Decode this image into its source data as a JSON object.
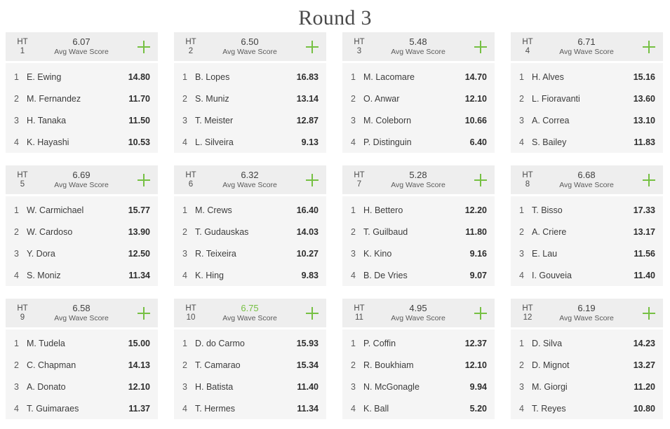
{
  "page": {
    "title": "Round 3",
    "heat_label": "HT",
    "avg_caption": "Avg Wave Score",
    "add_icon": "plus-icon",
    "accent_color": "#76c043",
    "header_bg": "#eeeeee",
    "body_bg": "#f5f5f5"
  },
  "heats": [
    {
      "heat_label": "HT",
      "heat_number": "1",
      "avg_wave_score": "6.07",
      "avg_caption": "Avg Wave Score",
      "highlighted": false,
      "athletes": [
        {
          "rank": "1",
          "name": "E. Ewing",
          "score": "14.80"
        },
        {
          "rank": "2",
          "name": "M. Fernandez",
          "score": "11.70"
        },
        {
          "rank": "3",
          "name": "H. Tanaka",
          "score": "11.50"
        },
        {
          "rank": "4",
          "name": "K. Hayashi",
          "score": "10.53"
        }
      ]
    },
    {
      "heat_label": "HT",
      "heat_number": "2",
      "avg_wave_score": "6.50",
      "avg_caption": "Avg Wave Score",
      "highlighted": false,
      "athletes": [
        {
          "rank": "1",
          "name": "B. Lopes",
          "score": "16.83"
        },
        {
          "rank": "2",
          "name": "S. Muniz",
          "score": "13.14"
        },
        {
          "rank": "3",
          "name": "T. Meister",
          "score": "12.87"
        },
        {
          "rank": "4",
          "name": "L. Silveira",
          "score": "9.13"
        }
      ]
    },
    {
      "heat_label": "HT",
      "heat_number": "3",
      "avg_wave_score": "5.48",
      "avg_caption": "Avg Wave Score",
      "highlighted": false,
      "athletes": [
        {
          "rank": "1",
          "name": "M. Lacomare",
          "score": "14.70"
        },
        {
          "rank": "2",
          "name": "O. Anwar",
          "score": "12.10"
        },
        {
          "rank": "3",
          "name": "M. Coleborn",
          "score": "10.66"
        },
        {
          "rank": "4",
          "name": "P. Distinguin",
          "score": "6.40"
        }
      ]
    },
    {
      "heat_label": "HT",
      "heat_number": "4",
      "avg_wave_score": "6.71",
      "avg_caption": "Avg Wave Score",
      "highlighted": false,
      "athletes": [
        {
          "rank": "1",
          "name": "H. Alves",
          "score": "15.16"
        },
        {
          "rank": "2",
          "name": "L. Fioravanti",
          "score": "13.60"
        },
        {
          "rank": "3",
          "name": "A. Correa",
          "score": "13.10"
        },
        {
          "rank": "4",
          "name": "S. Bailey",
          "score": "11.83"
        }
      ]
    },
    {
      "heat_label": "HT",
      "heat_number": "5",
      "avg_wave_score": "6.69",
      "avg_caption": "Avg Wave Score",
      "highlighted": false,
      "athletes": [
        {
          "rank": "1",
          "name": "W. Carmichael",
          "score": "15.77"
        },
        {
          "rank": "2",
          "name": "W. Cardoso",
          "score": "13.90"
        },
        {
          "rank": "3",
          "name": "Y. Dora",
          "score": "12.50"
        },
        {
          "rank": "4",
          "name": "S. Moniz",
          "score": "11.34"
        }
      ]
    },
    {
      "heat_label": "HT",
      "heat_number": "6",
      "avg_wave_score": "6.32",
      "avg_caption": "Avg Wave Score",
      "highlighted": false,
      "athletes": [
        {
          "rank": "1",
          "name": "M. Crews",
          "score": "16.40"
        },
        {
          "rank": "2",
          "name": "T. Gudauskas",
          "score": "14.03"
        },
        {
          "rank": "3",
          "name": "R. Teixeira",
          "score": "10.27"
        },
        {
          "rank": "4",
          "name": "K. Hing",
          "score": "9.83"
        }
      ]
    },
    {
      "heat_label": "HT",
      "heat_number": "7",
      "avg_wave_score": "5.28",
      "avg_caption": "Avg Wave Score",
      "highlighted": false,
      "athletes": [
        {
          "rank": "1",
          "name": "H. Bettero",
          "score": "12.20"
        },
        {
          "rank": "2",
          "name": "T. Guilbaud",
          "score": "11.80"
        },
        {
          "rank": "3",
          "name": "K. Kino",
          "score": "9.16"
        },
        {
          "rank": "4",
          "name": "B. De Vries",
          "score": "9.07"
        }
      ]
    },
    {
      "heat_label": "HT",
      "heat_number": "8",
      "avg_wave_score": "6.68",
      "avg_caption": "Avg Wave Score",
      "highlighted": false,
      "athletes": [
        {
          "rank": "1",
          "name": "T. Bisso",
          "score": "17.33"
        },
        {
          "rank": "2",
          "name": "A. Criere",
          "score": "13.17"
        },
        {
          "rank": "3",
          "name": "E. Lau",
          "score": "11.56"
        },
        {
          "rank": "4",
          "name": "I. Gouveia",
          "score": "11.40"
        }
      ]
    },
    {
      "heat_label": "HT",
      "heat_number": "9",
      "avg_wave_score": "6.58",
      "avg_caption": "Avg Wave Score",
      "highlighted": false,
      "athletes": [
        {
          "rank": "1",
          "name": "M. Tudela",
          "score": "15.00"
        },
        {
          "rank": "2",
          "name": "C. Chapman",
          "score": "14.13"
        },
        {
          "rank": "3",
          "name": "A. Donato",
          "score": "12.10"
        },
        {
          "rank": "4",
          "name": "T. Guimaraes",
          "score": "11.37"
        }
      ]
    },
    {
      "heat_label": "HT",
      "heat_number": "10",
      "avg_wave_score": "6.75",
      "avg_caption": "Avg Wave Score",
      "highlighted": true,
      "athletes": [
        {
          "rank": "1",
          "name": "D. do Carmo",
          "score": "15.93"
        },
        {
          "rank": "2",
          "name": "T. Camarao",
          "score": "15.34"
        },
        {
          "rank": "3",
          "name": "H. Batista",
          "score": "11.40"
        },
        {
          "rank": "4",
          "name": "T. Hermes",
          "score": "11.34"
        }
      ]
    },
    {
      "heat_label": "HT",
      "heat_number": "11",
      "avg_wave_score": "4.95",
      "avg_caption": "Avg Wave Score",
      "highlighted": false,
      "athletes": [
        {
          "rank": "1",
          "name": "P. Coffin",
          "score": "12.37"
        },
        {
          "rank": "2",
          "name": "R. Boukhiam",
          "score": "12.10"
        },
        {
          "rank": "3",
          "name": "N. McGonagle",
          "score": "9.94"
        },
        {
          "rank": "4",
          "name": "K. Ball",
          "score": "5.20"
        }
      ]
    },
    {
      "heat_label": "HT",
      "heat_number": "12",
      "avg_wave_score": "6.19",
      "avg_caption": "Avg Wave Score",
      "highlighted": false,
      "athletes": [
        {
          "rank": "1",
          "name": "D. Silva",
          "score": "14.23"
        },
        {
          "rank": "2",
          "name": "D. Mignot",
          "score": "13.27"
        },
        {
          "rank": "3",
          "name": "M. Giorgi",
          "score": "11.20"
        },
        {
          "rank": "4",
          "name": "T. Reyes",
          "score": "10.80"
        }
      ]
    }
  ]
}
